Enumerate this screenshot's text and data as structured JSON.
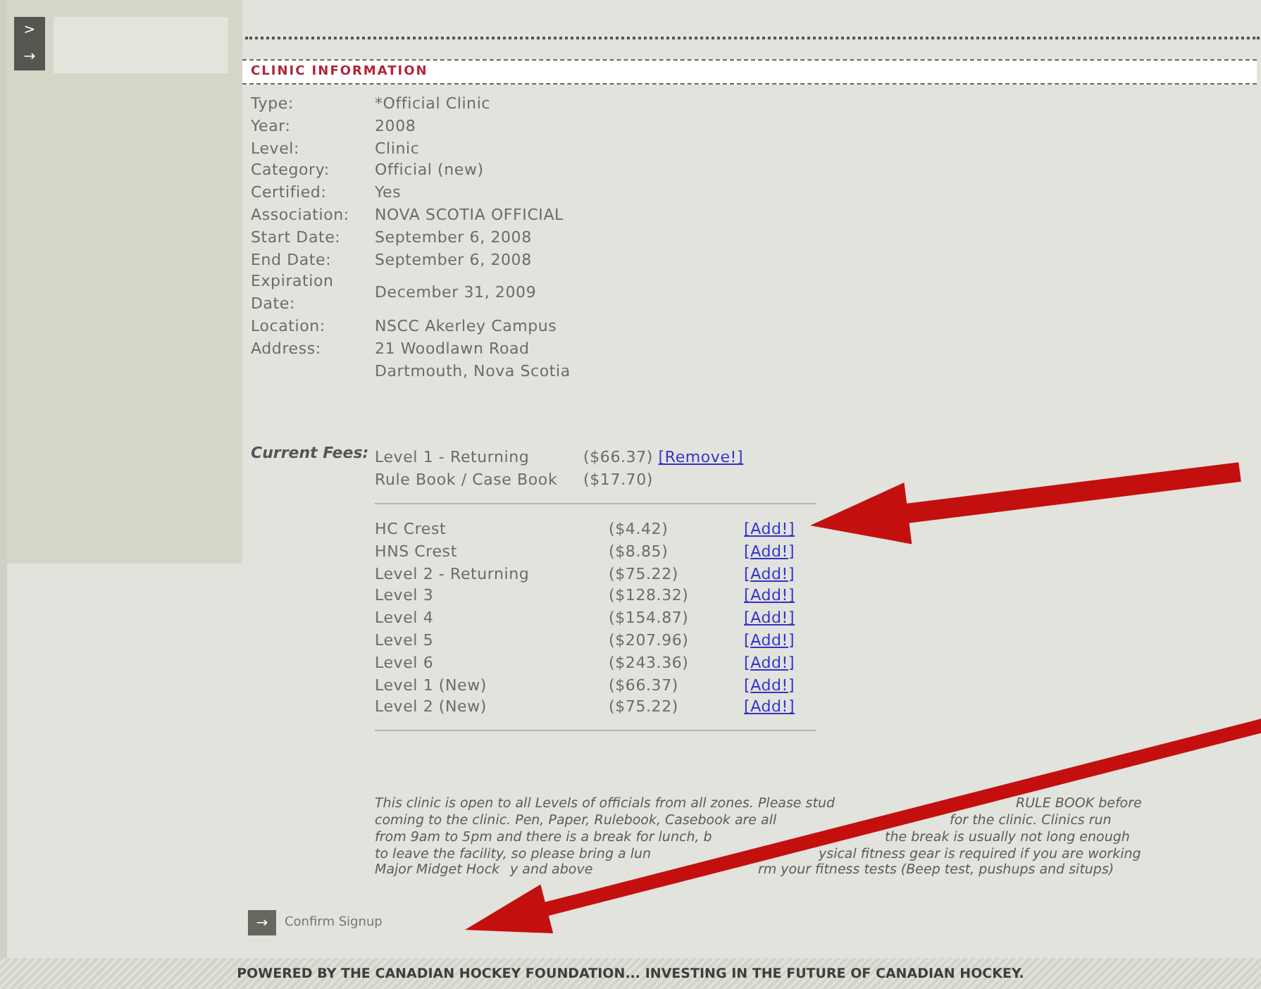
{
  "sidebar": {
    "icons": [
      ">",
      "→"
    ]
  },
  "section": {
    "title": "CLINIC INFORMATION"
  },
  "info": [
    {
      "label": "Type:",
      "value": "*Official Clinic"
    },
    {
      "label": "Year:",
      "value": "2008"
    },
    {
      "label": "Level:",
      "value": "Clinic"
    },
    {
      "label": "Category:",
      "value": "Official (new)"
    },
    {
      "label": "Certified:",
      "value": "Yes"
    },
    {
      "label": "Association:",
      "value": "NOVA SCOTIA OFFICIAL"
    },
    {
      "label": "Start Date:",
      "value": "September 6, 2008"
    },
    {
      "label": "End Date:",
      "value": "September 6, 2008"
    },
    {
      "label": "Expiration Date:",
      "value": "December 31, 2009"
    },
    {
      "label": "Location:",
      "value": "NSCC Akerley Campus"
    },
    {
      "label": "Address:",
      "value": "21 Woodlawn Road\nDartmouth, Nova Scotia"
    }
  ],
  "fees": {
    "label": "Current Fees:",
    "current": [
      {
        "name": "Level 1 - Returning",
        "price": "($66.37)",
        "action": "[Remove!]"
      },
      {
        "name": "Rule Book / Case Book",
        "price": "($17.70)"
      }
    ],
    "available": [
      {
        "name": "HC Crest",
        "price": "($4.42)",
        "action": "[Add!]"
      },
      {
        "name": "HNS Crest",
        "price": "($8.85)",
        "action": "[Add!]"
      },
      {
        "name": "Level 2 - Returning",
        "price": "($75.22)",
        "action": "[Add!]"
      },
      {
        "name": "Level 3",
        "price": "($128.32)",
        "action": "[Add!]"
      },
      {
        "name": "Level 4",
        "price": "($154.87)",
        "action": "[Add!]"
      },
      {
        "name": "Level 5",
        "price": "($207.96)",
        "action": "[Add!]"
      },
      {
        "name": "Level 6",
        "price": "($243.36)",
        "action": "[Add!]"
      },
      {
        "name": "Level 1 (New)",
        "price": "($66.37)",
        "action": "[Add!]"
      },
      {
        "name": "Level 2 (New)",
        "price": "($75.22)",
        "action": "[Add!]"
      }
    ]
  },
  "notes": [
    [
      "This clinic is open to all Levels of officials from all zones. Please stud",
      "RULE BOOK before"
    ],
    [
      "coming to the clinic. Pen, Paper, Rulebook, Casebook are all",
      "for the clinic. Clinics run"
    ],
    [
      "from 9am to 5pm and there is a break for lunch, b",
      "the break is usually not long enough"
    ],
    [
      "to leave the facility, so please bring a lun",
      "ysical fitness gear is required if you are working"
    ],
    [
      "Major Midget Hock",
      "y and above",
      "rm your fitness tests (Beep test, pushups and situps)"
    ]
  ],
  "confirm_button": {
    "icon": "→",
    "label": "Confirm Signup"
  },
  "footer": "POWERED BY THE CANADIAN HOCKEY FOUNDATION... INVESTING IN THE FUTURE OF CANADIAN HOCKEY."
}
